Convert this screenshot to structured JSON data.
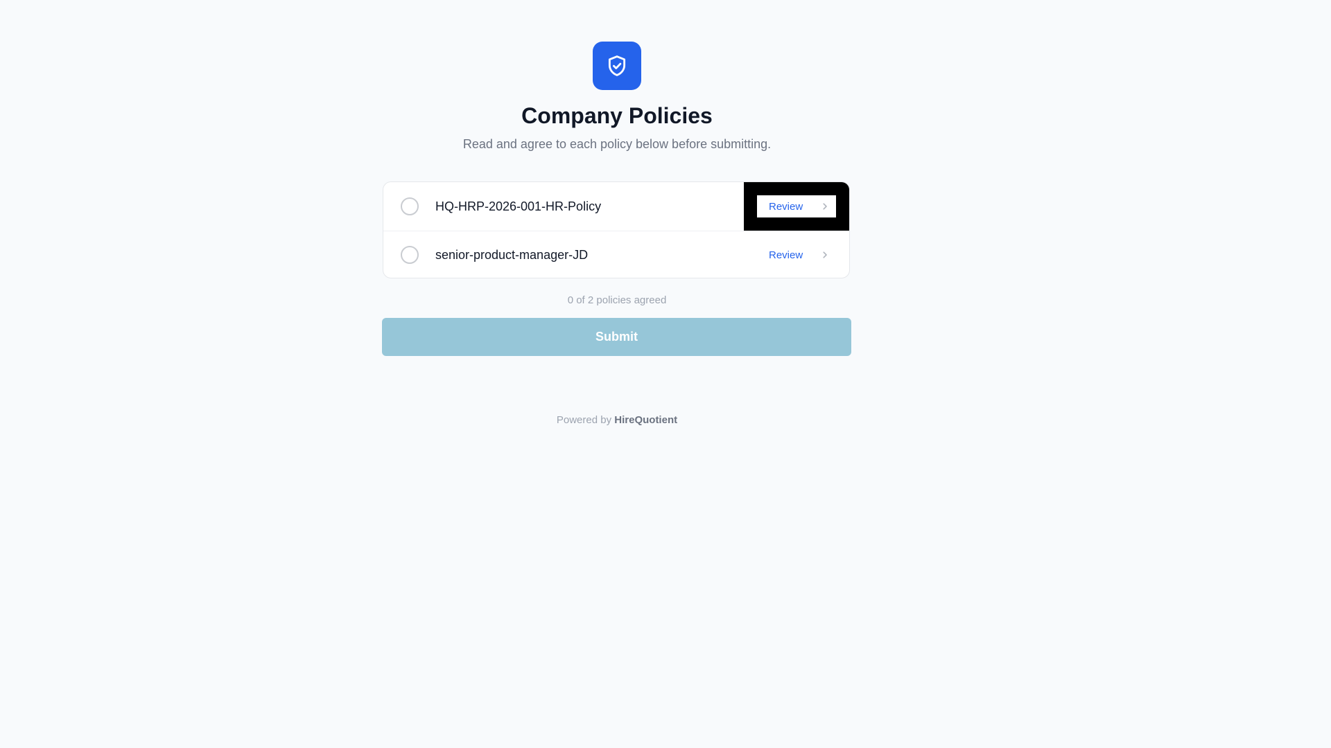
{
  "header": {
    "logo_icon": "shield-check-icon",
    "accent_color": "#2563eb",
    "title": "Company Policies",
    "subtitle": "Read and agree to each policy below before submitting."
  },
  "policies": [
    {
      "name": "HQ-HRP-2026-001-HR-Policy",
      "review_label": "Review",
      "agreed": false
    },
    {
      "name": "senior-product-manager-JD",
      "review_label": "Review",
      "agreed": false
    }
  ],
  "progress": {
    "text": "0 of 2 policies agreed",
    "agreed": 0,
    "total": 2
  },
  "submit": {
    "label": "Submit",
    "disabled": true,
    "color": "#96c6d8"
  },
  "footer": {
    "prefix": "Powered by",
    "brand": "HireQuotient"
  }
}
